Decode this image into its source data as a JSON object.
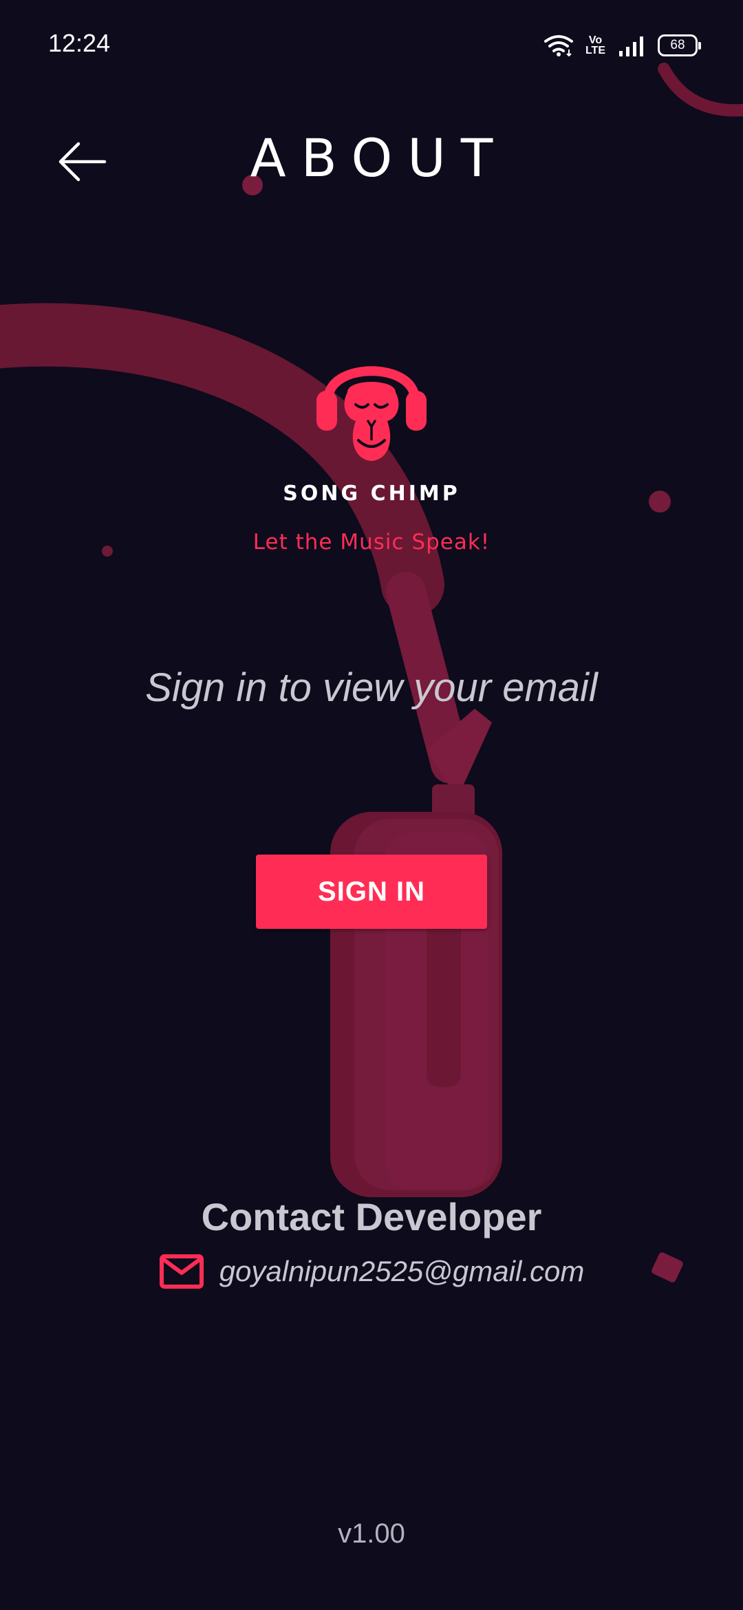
{
  "status_bar": {
    "time": "12:24",
    "volte_top": "Vo",
    "volte_bottom": "LTE",
    "battery": "68",
    "icons": [
      "wifi-icon",
      "volte-icon",
      "signal-icon",
      "battery-icon"
    ]
  },
  "header": {
    "title": "ABOUT",
    "back_icon": "arrow-left-icon"
  },
  "brand": {
    "name": "SONG CHIMP",
    "tagline": "Let the Music Speak!",
    "logo_icon": "chimp-headphones-logo"
  },
  "auth": {
    "prompt": "Sign in to view your email",
    "signin_label": "SIGN IN"
  },
  "contact": {
    "title": "Contact Developer",
    "email": "goyalnipun2525@gmail.com",
    "mail_icon": "mail-icon"
  },
  "footer": {
    "version": "v1.00"
  },
  "colors": {
    "background": "#0d0b1c",
    "accent": "#ff2d55",
    "headphone_art": "#7a1a3a",
    "text_primary": "#ffffff",
    "text_muted": "#c9c7d0"
  }
}
